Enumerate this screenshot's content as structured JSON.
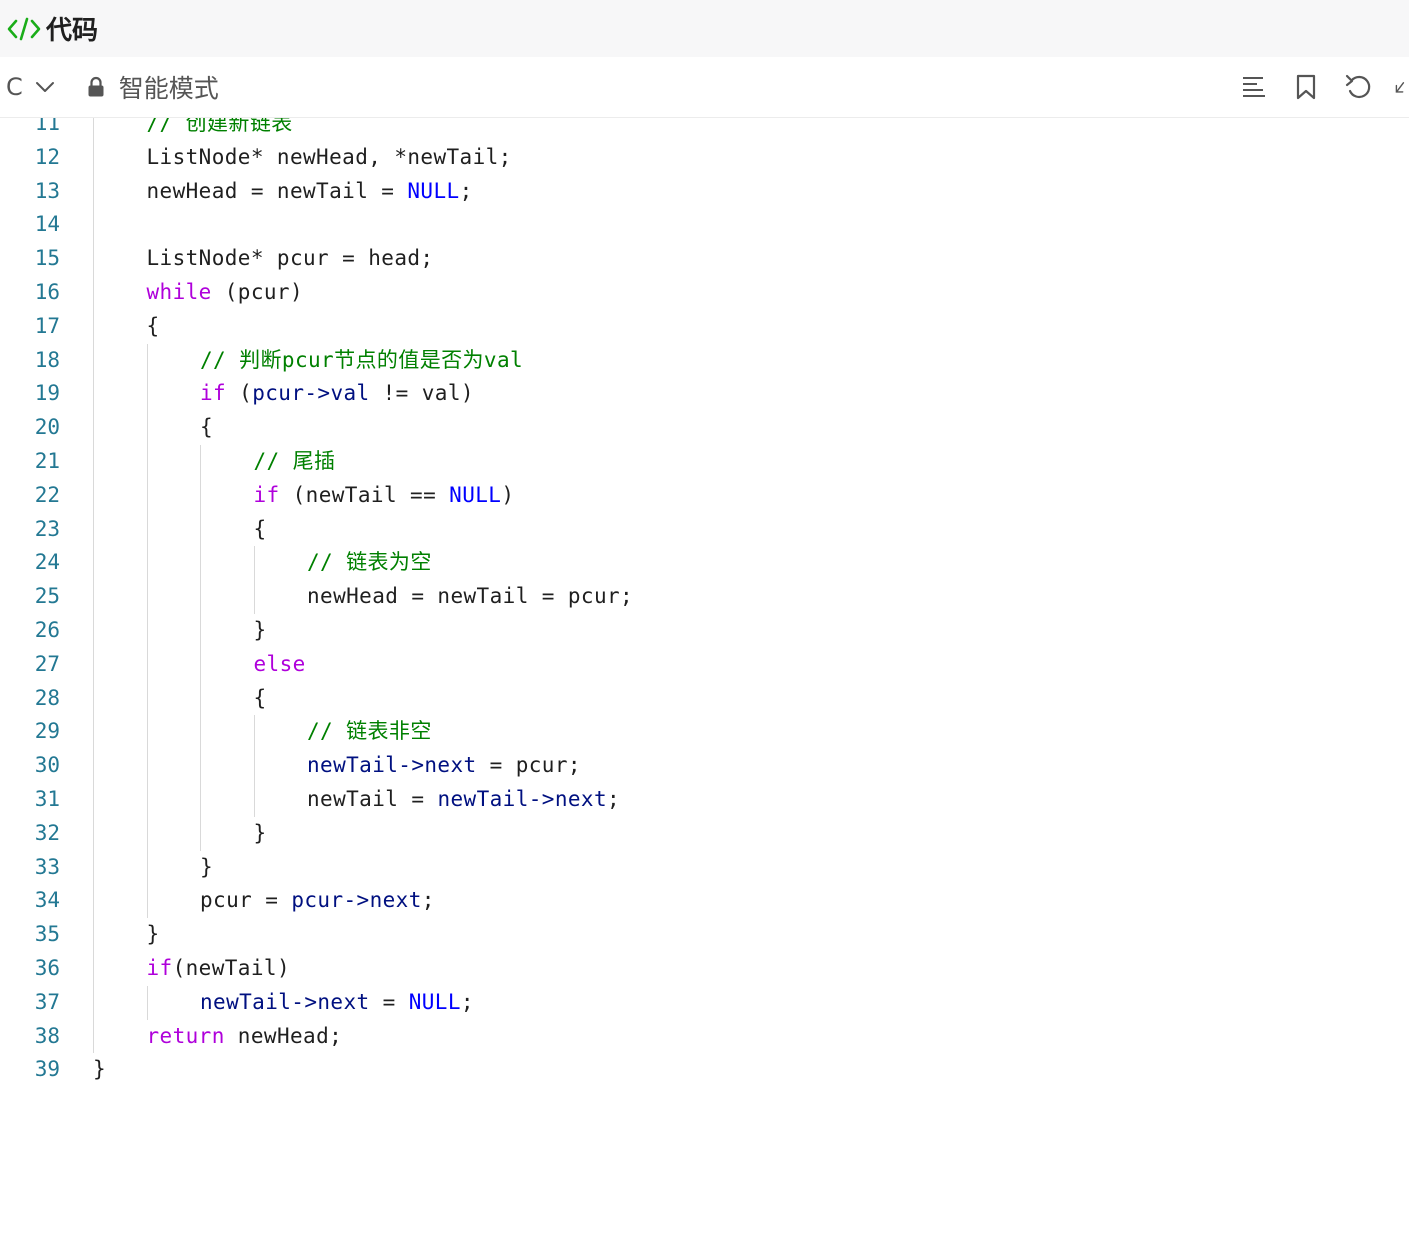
{
  "header": {
    "title": "代码"
  },
  "toolbar": {
    "language": "C",
    "mode_label": "智能模式",
    "icons": [
      "format-icon",
      "bookmark-icon",
      "undo-icon",
      "collapse-icon"
    ]
  },
  "colors": {
    "keyword": "#af00db",
    "comment": "#008000",
    "constant": "#0000ff",
    "member": "#001080",
    "line_number": "#237893",
    "accent": "#1aad19"
  },
  "code": {
    "lines": [
      {
        "n": "11",
        "indent": 1,
        "t": [
          [
            "cm",
            "// 创建新链表"
          ]
        ]
      },
      {
        "n": "12",
        "indent": 1,
        "t": [
          [
            "id",
            "ListNode* newHead, *newTail;"
          ]
        ]
      },
      {
        "n": "13",
        "indent": 1,
        "t": [
          [
            "id",
            "newHead = newTail = "
          ],
          [
            "const",
            "NULL"
          ],
          [
            "id",
            ";"
          ]
        ]
      },
      {
        "n": "14",
        "indent": 1,
        "t": []
      },
      {
        "n": "15",
        "indent": 1,
        "t": [
          [
            "id",
            "ListNode* pcur = head;"
          ]
        ]
      },
      {
        "n": "16",
        "indent": 1,
        "t": [
          [
            "kw",
            "while"
          ],
          [
            "id",
            " (pcur)"
          ]
        ]
      },
      {
        "n": "17",
        "indent": 1,
        "t": [
          [
            "id",
            "{"
          ]
        ]
      },
      {
        "n": "18",
        "indent": 2,
        "t": [
          [
            "cm",
            "// 判断pcur节点的值是否为val"
          ]
        ]
      },
      {
        "n": "19",
        "indent": 2,
        "t": [
          [
            "kw",
            "if"
          ],
          [
            "id",
            " ("
          ],
          [
            "mem",
            "pcur->val"
          ],
          [
            "id",
            " != val)"
          ]
        ]
      },
      {
        "n": "20",
        "indent": 2,
        "t": [
          [
            "id",
            "{"
          ]
        ]
      },
      {
        "n": "21",
        "indent": 3,
        "t": [
          [
            "cm",
            "// 尾插"
          ]
        ]
      },
      {
        "n": "22",
        "indent": 3,
        "t": [
          [
            "kw",
            "if"
          ],
          [
            "id",
            " (newTail == "
          ],
          [
            "const",
            "NULL"
          ],
          [
            "id",
            ")"
          ]
        ]
      },
      {
        "n": "23",
        "indent": 3,
        "t": [
          [
            "id",
            "{"
          ]
        ]
      },
      {
        "n": "24",
        "indent": 4,
        "t": [
          [
            "cm",
            "// 链表为空"
          ]
        ]
      },
      {
        "n": "25",
        "indent": 4,
        "t": [
          [
            "id",
            "newHead = newTail = pcur;"
          ]
        ]
      },
      {
        "n": "26",
        "indent": 3,
        "t": [
          [
            "id",
            "}"
          ]
        ]
      },
      {
        "n": "27",
        "indent": 3,
        "t": [
          [
            "kw",
            "else"
          ]
        ]
      },
      {
        "n": "28",
        "indent": 3,
        "t": [
          [
            "id",
            "{"
          ]
        ]
      },
      {
        "n": "29",
        "indent": 4,
        "t": [
          [
            "cm",
            "// 链表非空"
          ]
        ]
      },
      {
        "n": "30",
        "indent": 4,
        "t": [
          [
            "mem",
            "newTail->next"
          ],
          [
            "id",
            " = pcur;"
          ]
        ]
      },
      {
        "n": "31",
        "indent": 4,
        "t": [
          [
            "id",
            "newTail = "
          ],
          [
            "mem",
            "newTail->next"
          ],
          [
            "id",
            ";"
          ]
        ]
      },
      {
        "n": "32",
        "indent": 3,
        "t": [
          [
            "id",
            "}"
          ]
        ]
      },
      {
        "n": "33",
        "indent": 2,
        "t": [
          [
            "id",
            "}"
          ]
        ]
      },
      {
        "n": "34",
        "indent": 2,
        "t": [
          [
            "id",
            "pcur = "
          ],
          [
            "mem",
            "pcur->next"
          ],
          [
            "id",
            ";"
          ]
        ]
      },
      {
        "n": "35",
        "indent": 1,
        "t": [
          [
            "id",
            "}"
          ]
        ]
      },
      {
        "n": "36",
        "indent": 1,
        "t": [
          [
            "kw",
            "if"
          ],
          [
            "id",
            "(newTail)"
          ]
        ]
      },
      {
        "n": "37",
        "indent": 2,
        "t": [
          [
            "mem",
            "newTail->next"
          ],
          [
            "id",
            " = "
          ],
          [
            "const",
            "NULL"
          ],
          [
            "id",
            ";"
          ]
        ]
      },
      {
        "n": "38",
        "indent": 1,
        "t": [
          [
            "kw",
            "return"
          ],
          [
            "id",
            " newHead;"
          ]
        ]
      },
      {
        "n": "39",
        "indent": 0,
        "t": [
          [
            "id",
            "}"
          ]
        ]
      }
    ]
  }
}
